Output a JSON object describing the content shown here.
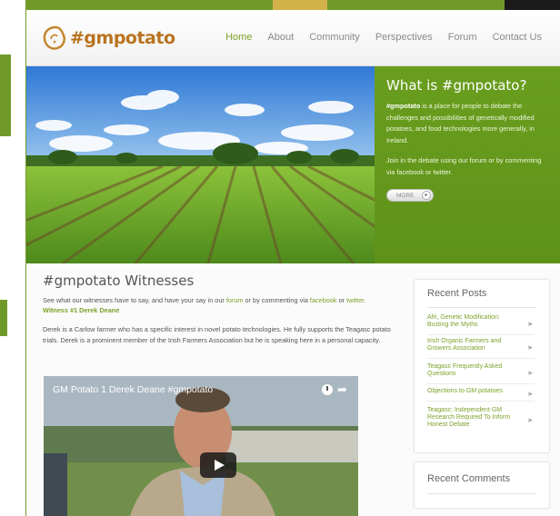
{
  "site": {
    "logo_text": "#gmpotato",
    "nav": [
      "Home",
      "About",
      "Community",
      "Perspectives",
      "Forum",
      "Contact Us"
    ]
  },
  "hero": {
    "title": "What is #gmpotato?",
    "p1_bold": "#gmpotato",
    "p1_rest": " is a place for people to debate the challenges and possibilities of genetically modified potatoes, and food technologies more generally, in Ireland.",
    "p2": "Join in the debate using our forum or by commenting via facebook or twitter.",
    "more_label": "MORE"
  },
  "content": {
    "title": "#gmpotato Witnesses",
    "intro_1": "See what our witnesses have to say, and have your say in our ",
    "intro_forum": "forum",
    "intro_2": " or by commenting via ",
    "intro_facebook": "facebook",
    "intro_3": " or ",
    "intro_twitter": "twitter",
    "intro_4": ".",
    "witness_label": "Witness #1 Derek Deane",
    "paragraph": "Derek is a Carlow farmer who has a specific interest in novel potato technologies. He fully supports the Teagasc potato trials. Derek is a prominent member of the Irish Farmers Association but he is speaking here in a personal capacity.",
    "video_title": "GM Potato 1 Derek Deane #gmpotato"
  },
  "sidebar": {
    "recent_posts_title": "Recent Posts",
    "posts": [
      "Afri, Genetic Modification: Busting the Myths",
      "Irish Organic Farmers and Growers Association",
      "Teagasc Frequently Asked Questions",
      "Objections to GM potatoes",
      "Teagasc: Independent GM Research Required To Inform Honest Debate"
    ],
    "recent_comments_title": "Recent Comments"
  },
  "colors": {
    "accent_green": "#7da12a",
    "hero_panel": "#5f9219",
    "logo_orange": "#b9731f"
  }
}
